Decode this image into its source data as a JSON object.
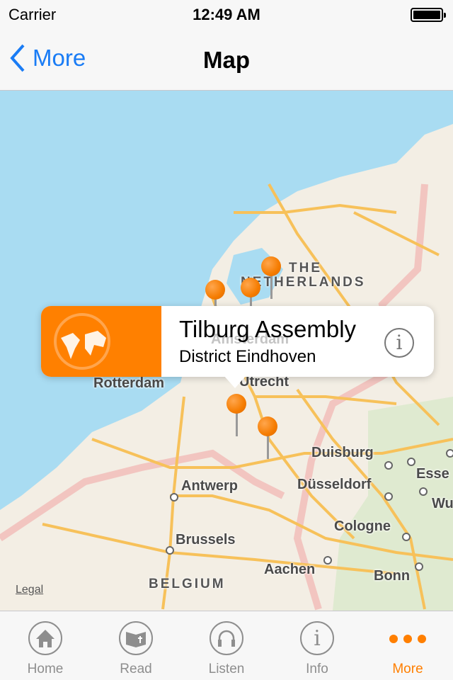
{
  "status": {
    "carrier": "Carrier",
    "time": "12:49 AM"
  },
  "nav": {
    "back_label": "More",
    "title": "Map"
  },
  "map": {
    "labels": {
      "netherlands_1": "THE",
      "netherlands_2": "NETHERLANDS",
      "amsterdam": "Amsterdam",
      "rotterdam": "Rotterdam",
      "utrecht": "Utrecht",
      "duisburg": "Duisburg",
      "essen": "Esse",
      "dusseldorf": "Düsseldorf",
      "wu": "Wu",
      "antwerp": "Antwerp",
      "cologne": "Cologne",
      "brussels": "Brussels",
      "aachen": "Aachen",
      "bonn": "Bonn",
      "belgium": "BELGIUM"
    },
    "legal": "Legal",
    "pin_color": "#f57c00",
    "callout": {
      "title": "Tilburg Assembly",
      "subtitle": "District Eindhoven",
      "image_color": "#ff8000"
    }
  },
  "tabs": [
    {
      "label": "Home",
      "icon": "home-icon"
    },
    {
      "label": "Read",
      "icon": "book-icon"
    },
    {
      "label": "Listen",
      "icon": "headphones-icon"
    },
    {
      "label": "Info",
      "icon": "info-icon"
    },
    {
      "label": "More",
      "icon": "more-icon",
      "active": true
    }
  ],
  "colors": {
    "accent": "#ff7f00",
    "link": "#1a7cf5",
    "sea": "#a9dcf2",
    "land": "#f3eee4"
  }
}
